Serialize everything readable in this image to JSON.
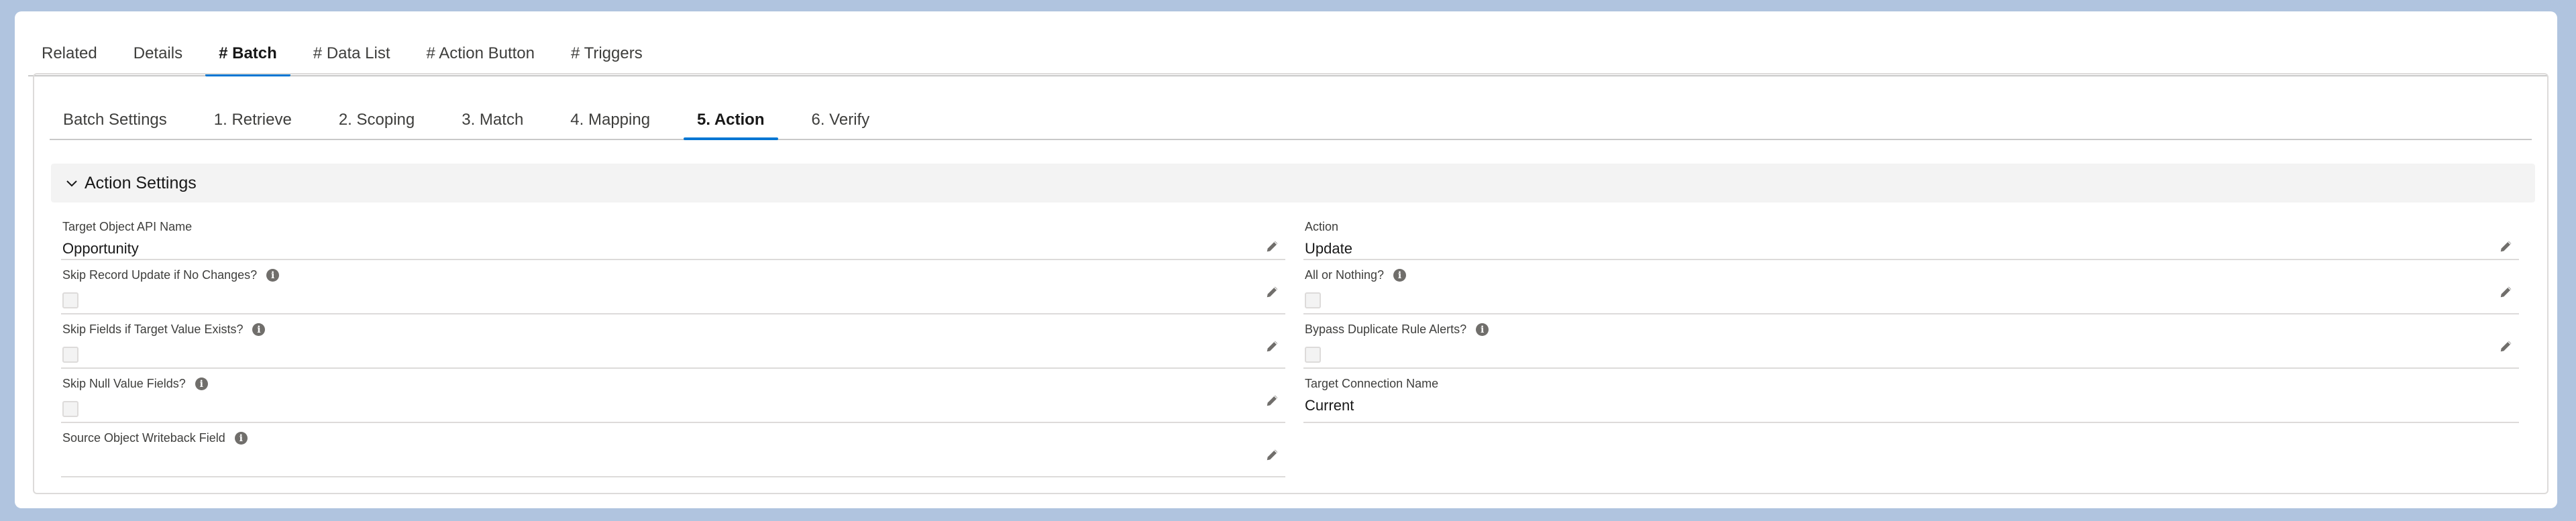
{
  "outer_tabs": [
    "Related",
    "Details",
    "# Batch",
    "# Data List",
    "# Action Button",
    "# Triggers"
  ],
  "outer_active": "# Batch",
  "inner_tabs": [
    "Batch Settings",
    "1. Retrieve",
    "2. Scoping",
    "3. Match",
    "4. Mapping",
    "5. Action",
    "6. Verify"
  ],
  "inner_active": "5. Action",
  "section": {
    "title": "Action Settings"
  },
  "left_fields": {
    "target_object": {
      "label": "Target Object API Name",
      "value": "Opportunity"
    },
    "skip_record_update": {
      "label": "Skip Record Update if No Changes?",
      "checked": false
    },
    "skip_fields": {
      "label": "Skip Fields if Target Value Exists?",
      "checked": false
    },
    "skip_null": {
      "label": "Skip Null Value Fields?",
      "checked": false
    },
    "source_writeback": {
      "label": "Source Object Writeback Field",
      "value": ""
    }
  },
  "right_fields": {
    "action": {
      "label": "Action",
      "value": "Update"
    },
    "all_or_nothing": {
      "label": "All or Nothing?",
      "checked": false
    },
    "bypass_duplicate": {
      "label": "Bypass Duplicate Rule Alerts?",
      "checked": false
    },
    "target_connection": {
      "label": "Target Connection Name",
      "value": "Current"
    }
  },
  "icons": {
    "info": "info-icon",
    "edit": "pencil-icon",
    "collapse": "chevron-down-icon"
  },
  "colors": {
    "accent": "#0176d3",
    "background": "#b0c4df"
  }
}
